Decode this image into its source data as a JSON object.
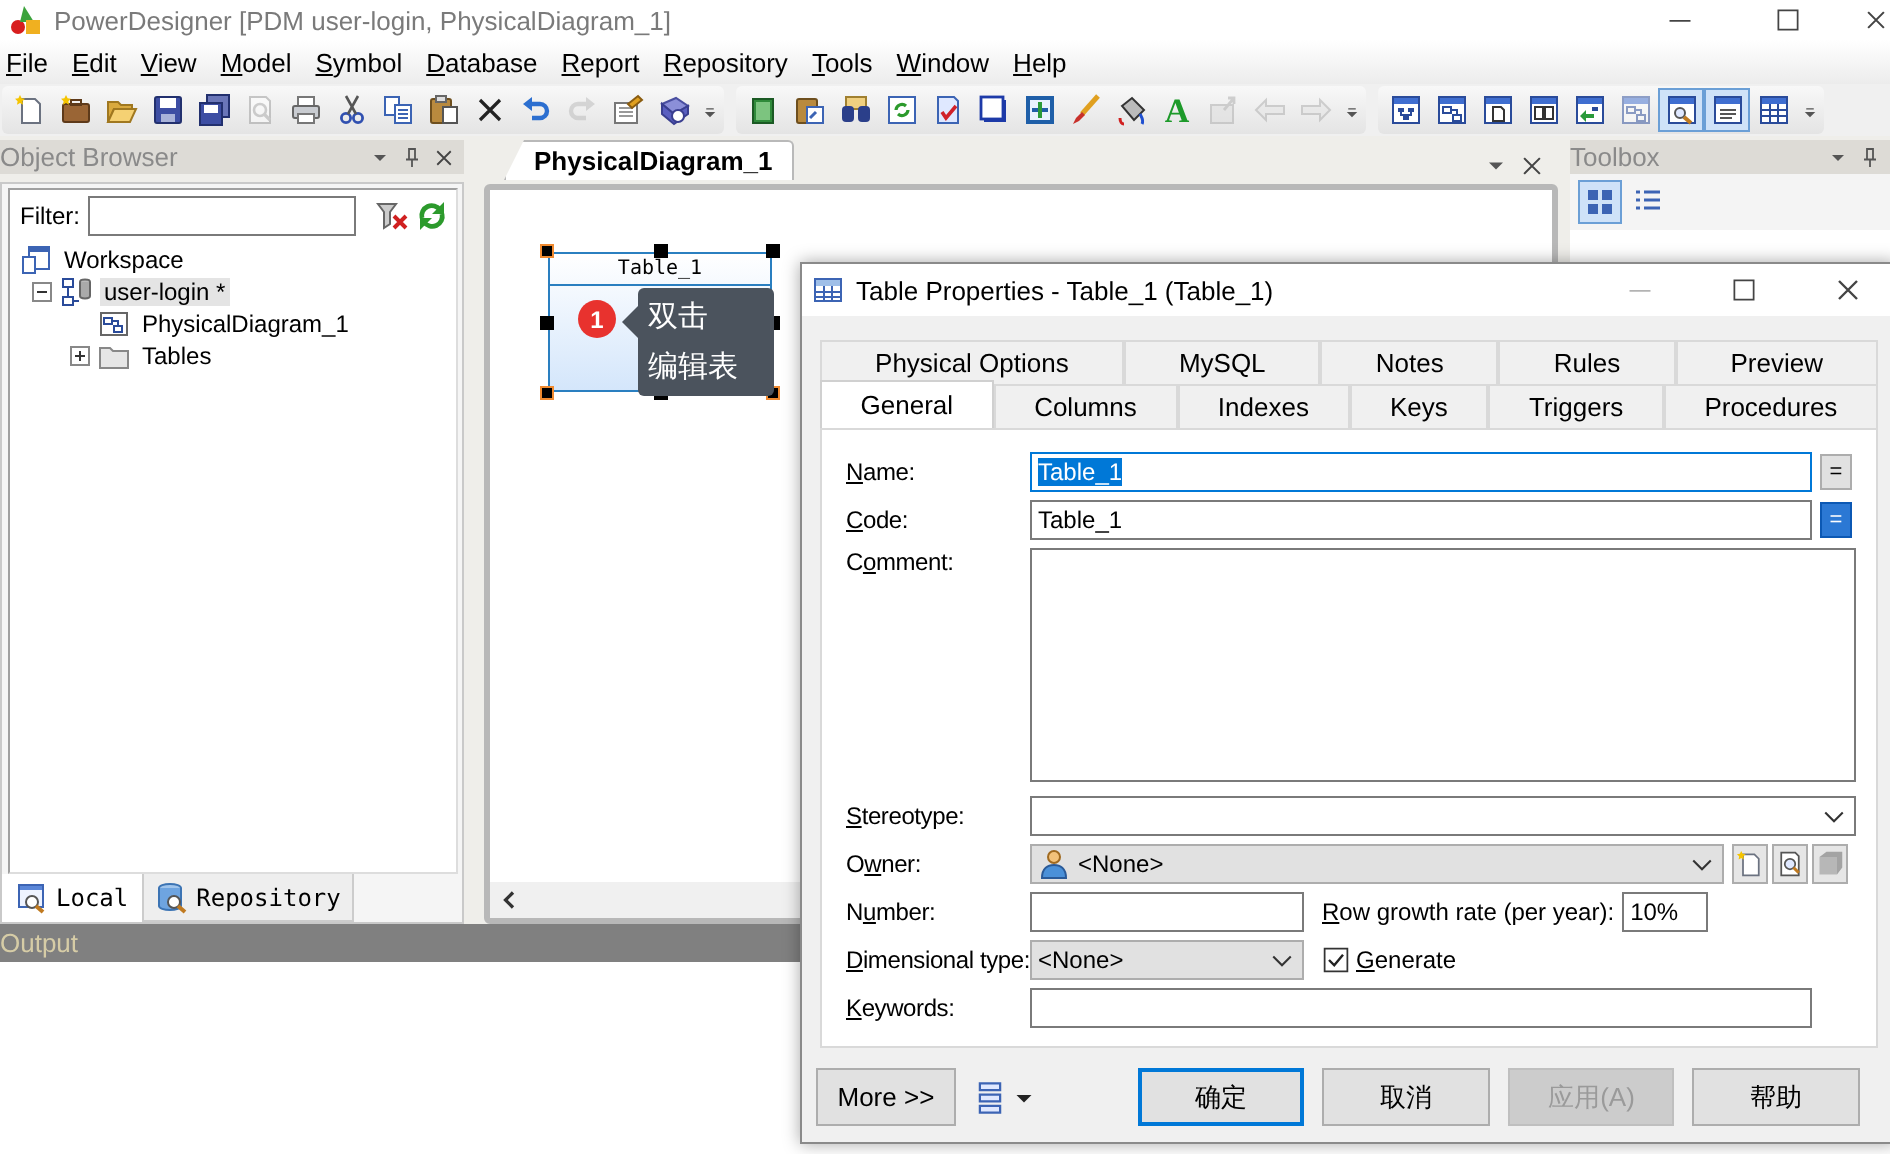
{
  "window": {
    "title": "PowerDesigner [PDM user-login, PhysicalDiagram_1]"
  },
  "menu": [
    {
      "label": "File"
    },
    {
      "label": "Edit"
    },
    {
      "label": "View"
    },
    {
      "label": "Model"
    },
    {
      "label": "Symbol"
    },
    {
      "label": "Database"
    },
    {
      "label": "Report"
    },
    {
      "label": "Repository"
    },
    {
      "label": "Tools"
    },
    {
      "label": "Window"
    },
    {
      "label": "Help"
    }
  ],
  "toolbars": [
    {
      "buttons": [
        {
          "kind": "new-document",
          "disabled": false
        },
        {
          "kind": "briefcase",
          "disabled": false
        },
        {
          "kind": "open-folder",
          "disabled": false
        },
        {
          "kind": "disk",
          "disabled": false
        },
        {
          "kind": "disks",
          "disabled": false
        },
        {
          "kind": "magnifier-page",
          "disabled": true
        },
        {
          "kind": "printer",
          "disabled": false
        },
        {
          "kind": "scissors",
          "disabled": false
        },
        {
          "kind": "copy",
          "disabled": false
        },
        {
          "kind": "clipboard",
          "disabled": false
        },
        {
          "kind": "cross",
          "disabled": false
        },
        {
          "kind": "undo",
          "disabled": false
        },
        {
          "kind": "redo",
          "disabled": true
        },
        {
          "kind": "property-sheet",
          "disabled": false
        },
        {
          "kind": "help-book",
          "disabled": false
        }
      ]
    },
    {
      "buttons": [
        {
          "kind": "framed-page",
          "disabled": false
        },
        {
          "kind": "clipboard-window",
          "disabled": false
        },
        {
          "kind": "binoculars",
          "disabled": false
        },
        {
          "kind": "refresh-window",
          "disabled": false
        },
        {
          "kind": "checked-page",
          "disabled": false
        },
        {
          "kind": "square",
          "disabled": false
        },
        {
          "kind": "cross-frame",
          "disabled": false
        },
        {
          "kind": "brush",
          "disabled": false
        },
        {
          "kind": "paint-bucket",
          "disabled": false
        },
        {
          "kind": "letter",
          "label": "A",
          "disabled": false
        },
        {
          "kind": "box-arrow",
          "disabled": true
        },
        {
          "kind": "arrow-left",
          "disabled": true
        },
        {
          "kind": "arrow-right",
          "disabled": true
        }
      ]
    },
    {
      "buttons": [
        {
          "kind": "window-tree",
          "disabled": false,
          "pressed": false
        },
        {
          "kind": "window-nodes",
          "disabled": false,
          "pressed": false
        },
        {
          "kind": "window-page",
          "disabled": false,
          "pressed": false
        },
        {
          "kind": "window-pages",
          "disabled": false,
          "pressed": false
        },
        {
          "kind": "window-arrow",
          "disabled": false,
          "pressed": false
        },
        {
          "kind": "window-nodes",
          "disabled": true,
          "pressed": false
        },
        {
          "kind": "window-magnifier",
          "disabled": false,
          "pressed": true
        },
        {
          "kind": "window-lines",
          "disabled": false,
          "pressed": true
        },
        {
          "kind": "window-table",
          "disabled": false,
          "pressed": false
        }
      ]
    }
  ],
  "object_browser": {
    "title": "Object Browser",
    "filter_label": "Filter:",
    "tree": [
      {
        "label": "Workspace",
        "kind": "workspace",
        "selected": false,
        "children": [
          {
            "label": "user-login *",
            "kind": "model",
            "selected": true,
            "expanded": true,
            "children": [
              {
                "label": "PhysicalDiagram_1",
                "kind": "diagram",
                "selected": false
              },
              {
                "label": "Tables",
                "kind": "folder",
                "selected": false,
                "expanded": false
              }
            ]
          }
        ]
      }
    ],
    "tabs": [
      {
        "label": "Local",
        "selected": true
      },
      {
        "label": "Repository",
        "selected": false
      }
    ]
  },
  "diagram": {
    "tabs": [
      {
        "label": "PhysicalDiagram_1",
        "selected": true
      }
    ],
    "table": {
      "name": "Table_1",
      "selected": true
    },
    "tooltip": {
      "badge": "1",
      "lines": [
        "双击",
        "编辑表"
      ]
    }
  },
  "toolbox": {
    "title": "Toolbox",
    "buttons": [
      {
        "kind": "grid",
        "pressed": true
      },
      {
        "kind": "list",
        "pressed": false
      }
    ]
  },
  "output": {
    "title": "Output"
  },
  "dialog": {
    "title": "Table Properties - Table_1 (Table_1)",
    "tab_rows": [
      [
        {
          "label": "Physical Options",
          "selected": false
        },
        {
          "label": "MySQL",
          "selected": false
        },
        {
          "label": "Notes",
          "selected": false
        },
        {
          "label": "Rules",
          "selected": false
        },
        {
          "label": "Preview",
          "selected": false
        }
      ],
      [
        {
          "label": "General",
          "selected": true
        },
        {
          "label": "Columns",
          "selected": false
        },
        {
          "label": "Indexes",
          "selected": false
        },
        {
          "label": "Keys",
          "selected": false
        },
        {
          "label": "Triggers",
          "selected": false
        },
        {
          "label": "Procedures",
          "selected": false
        }
      ]
    ],
    "fields": [
      {
        "kind": "text",
        "label": {
          "key": "N",
          "rest": "ame:"
        },
        "value": "Table_1",
        "value_selected": true,
        "eq_button": {
          "label": "=",
          "pressed": false
        }
      },
      {
        "kind": "text",
        "label": {
          "key": "C",
          "rest": "ode:"
        },
        "value": "Table_1",
        "value_selected": false,
        "eq_button": {
          "label": "=",
          "pressed": true
        }
      },
      {
        "kind": "textarea",
        "label": {
          "before": "C",
          "key": "o",
          "rest": "mment:"
        }
      },
      {
        "kind": "dropdown",
        "label": {
          "key": "S",
          "rest": "tereotype:"
        }
      },
      {
        "kind": "owner",
        "label": {
          "before": "O",
          "key": "w",
          "rest": "ner:"
        },
        "value": "<None>",
        "tools": [
          {
            "kind": "new",
            "disabled": false
          },
          {
            "kind": "properties",
            "disabled": false
          },
          {
            "kind": "box",
            "disabled": true
          }
        ]
      },
      {
        "kind": "pair",
        "label": {
          "before": "N",
          "key": "u",
          "rest": "mber:"
        },
        "side_label": {
          "key": "R",
          "rest": "ow growth rate (per year):"
        },
        "side_value": "10%"
      },
      {
        "kind": "dimensional",
        "label": {
          "key": "D",
          "rest": "imensional type:"
        },
        "value": "<None>",
        "check_label": {
          "key": "G",
          "rest": "enerate"
        },
        "checked": true
      },
      {
        "kind": "text",
        "label": {
          "key": "K",
          "rest": "eywords:"
        }
      }
    ],
    "buttons": [
      {
        "kind": "more",
        "label": "More >>"
      },
      {
        "kind": "layout-menu"
      },
      {
        "kind": "push",
        "label": "确定",
        "default": true,
        "disabled": false
      },
      {
        "kind": "push",
        "label": "取消",
        "default": false,
        "disabled": false
      },
      {
        "kind": "push",
        "label": "应用(A)",
        "default": false,
        "disabled": true
      },
      {
        "kind": "push",
        "label": "帮助",
        "default": false,
        "disabled": false
      }
    ]
  }
}
